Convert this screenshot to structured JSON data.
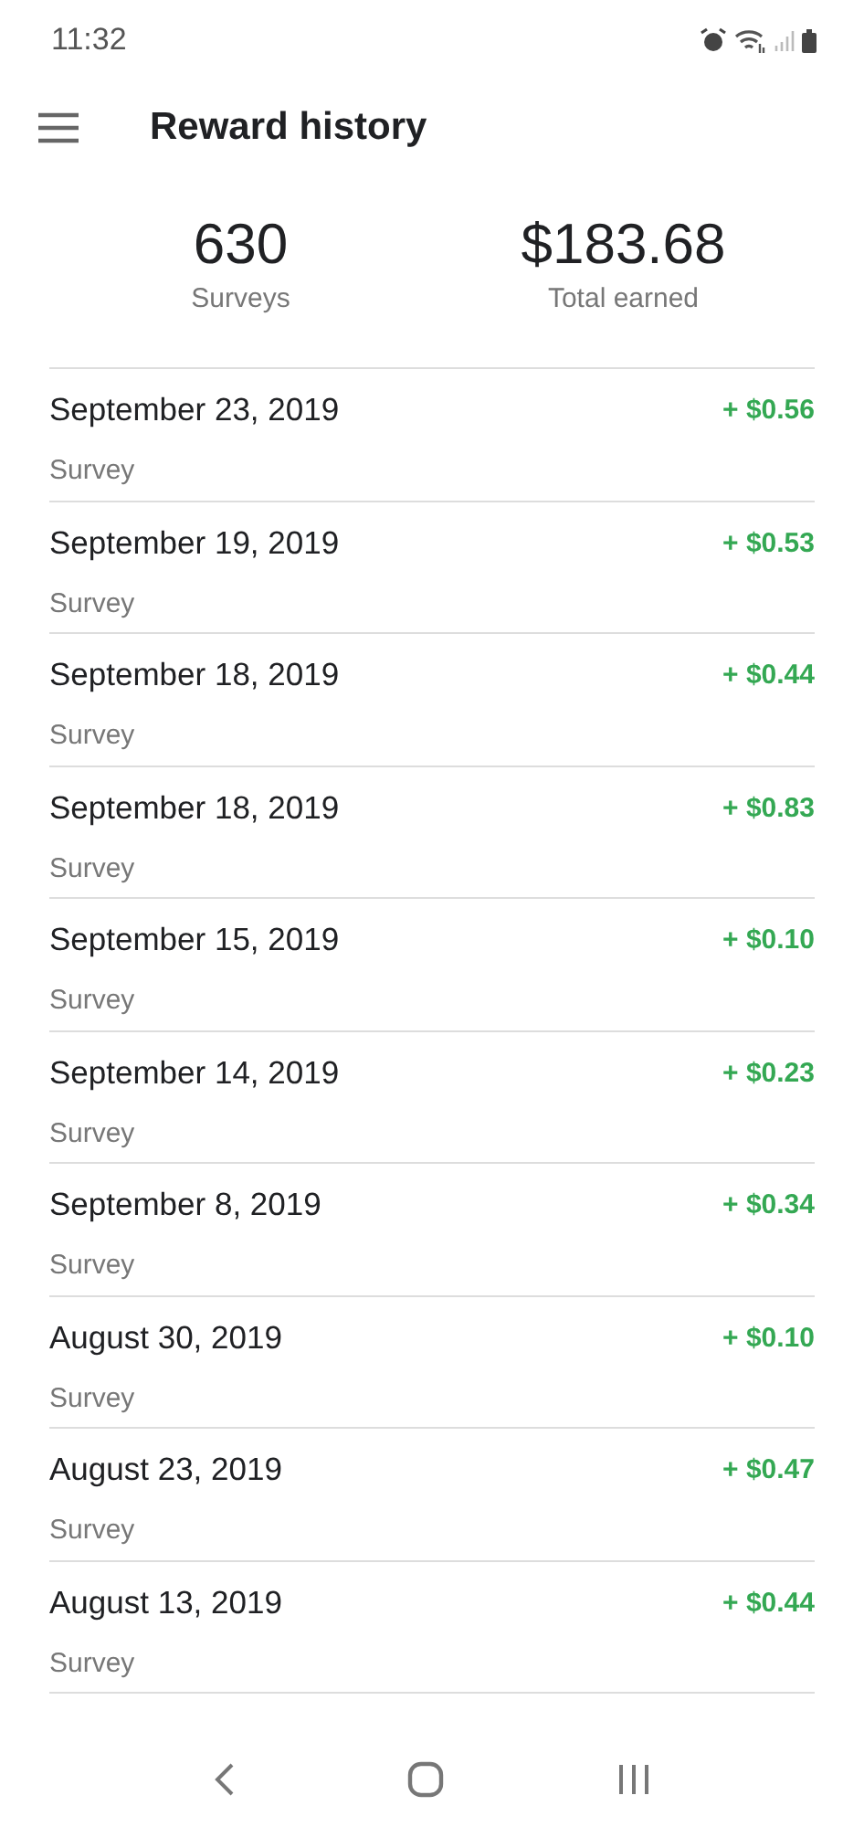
{
  "status_bar": {
    "time": "11:32"
  },
  "header": {
    "title": "Reward history"
  },
  "summary": [
    {
      "value": "630",
      "label": "Surveys"
    },
    {
      "value": "$183.68",
      "label": "Total earned"
    }
  ],
  "rewards": [
    {
      "date": "September 23, 2019",
      "type": "Survey",
      "amount": "+ $0.56"
    },
    {
      "date": "September 19, 2019",
      "type": "Survey",
      "amount": "+ $0.53"
    },
    {
      "date": "September 18, 2019",
      "type": "Survey",
      "amount": "+ $0.44"
    },
    {
      "date": "September 18, 2019",
      "type": "Survey",
      "amount": "+ $0.83"
    },
    {
      "date": "September 15, 2019",
      "type": "Survey",
      "amount": "+ $0.10"
    },
    {
      "date": "September 14, 2019",
      "type": "Survey",
      "amount": "+ $0.23"
    },
    {
      "date": "September 8, 2019",
      "type": "Survey",
      "amount": "+ $0.34"
    },
    {
      "date": "August 30, 2019",
      "type": "Survey",
      "amount": "+ $0.10"
    },
    {
      "date": "August 23, 2019",
      "type": "Survey",
      "amount": "+ $0.47"
    },
    {
      "date": "August 13, 2019",
      "type": "Survey",
      "amount": "+ $0.44"
    }
  ]
}
